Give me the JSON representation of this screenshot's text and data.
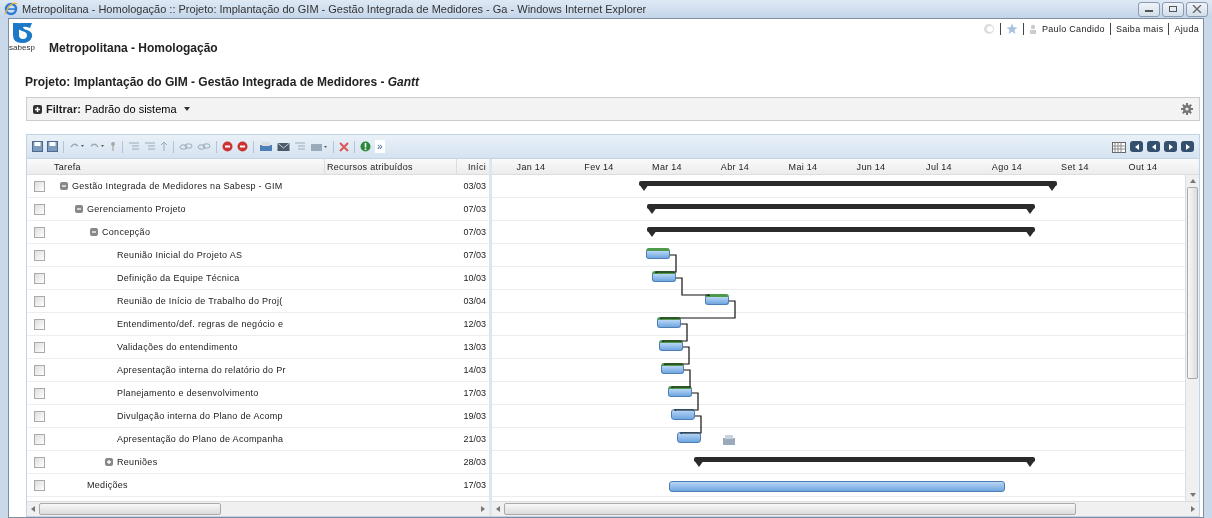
{
  "window": {
    "title": "Metropolitana - Homologação :: Projeto: Implantação do GIM - Gestão Integrada de Medidores - Ga - Windows Internet Explorer"
  },
  "header": {
    "logo_text": "sabesp",
    "app_name": "Metropolitana - Homologação",
    "user": "Paulo Candido",
    "links": [
      "Saiba mais",
      "Ajuda"
    ]
  },
  "page_title": "Projeto: Implantação do GIM - Gestão Integrada de Medidores - *Gantt*",
  "filter": {
    "label": "Filtrar:",
    "value": "Padrão do sistema"
  },
  "toolbar": {
    "more": "»"
  },
  "columns": [
    "Tarefa",
    "Recursos atribuídos",
    "Iníci"
  ],
  "months": [
    "Jan 14",
    "Fev 14",
    "Mar 14",
    "Abr 14",
    "Mai 14",
    "Jun 14",
    "Jul 14",
    "Ago 14",
    "Set 14",
    "Out 14"
  ],
  "tasks": [
    {
      "name": "Gestão Integrada de Medidores na Sabesp - GIM",
      "start": "03/03",
      "checked": false,
      "kind": "summary",
      "expanded": true,
      "children": [
        {
          "name": "Gerenciamento Projeto",
          "start": "07/03",
          "checked": false,
          "kind": "summary",
          "expanded": true,
          "children": [
            {
              "name": "Concepção",
              "start": "07/03",
              "checked": false,
              "kind": "summary",
              "expanded": true,
              "children": [
                {
                  "name": "Reunião Inicial do Projeto AS",
                  "start": "07/03",
                  "checked": false,
                  "kind": "task",
                  "complete": true
                },
                {
                  "name": "Definição da Equipe Técnica",
                  "start": "10/03",
                  "checked": false,
                  "kind": "task",
                  "complete": true
                },
                {
                  "name": "Reunião de Início de Trabalho do Proj(",
                  "start": "03/04",
                  "checked": false,
                  "kind": "task",
                  "complete": true
                },
                {
                  "name": "Entendimento/def. regras de negócio e",
                  "start": "12/03",
                  "checked": false,
                  "kind": "task",
                  "complete": true
                },
                {
                  "name": "Validações do entendimento",
                  "start": "13/03",
                  "checked": false,
                  "kind": "task",
                  "complete": true
                },
                {
                  "name": "Apresentação interna do relatório do Pr",
                  "start": "14/03",
                  "checked": false,
                  "kind": "task",
                  "complete": true
                },
                {
                  "name": "Planejamento e desenvolvimento",
                  "start": "17/03",
                  "checked": false,
                  "kind": "task",
                  "complete": true
                },
                {
                  "name": "Divulgação interna do Plano de Acomp",
                  "start": "19/03",
                  "checked": false,
                  "kind": "task",
                  "complete": false
                },
                {
                  "name": "Apresentação do Plano de Acompanha",
                  "start": "21/03",
                  "checked": false,
                  "kind": "task",
                  "complete": false
                },
                {
                  "name": "Reuniões",
                  "start": "28/03",
                  "checked": false,
                  "kind": "summary",
                  "expanded": false
                }
              ]
            }
          ]
        },
        {
          "name": "Medições",
          "start": "17/03",
          "checked": false,
          "kind": "task",
          "complete": false
        }
      ]
    }
  ]
}
